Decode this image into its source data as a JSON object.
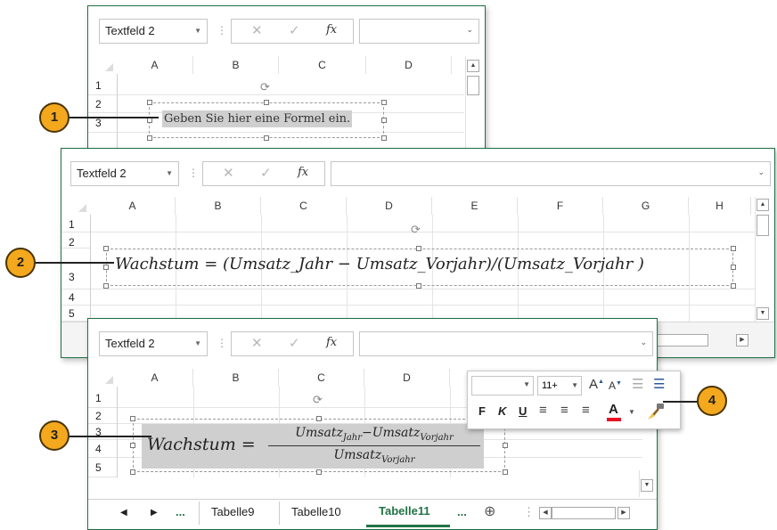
{
  "name_box": "Textfeld 2",
  "fx_label": "fx",
  "columns": [
    "A",
    "B",
    "C",
    "D",
    "E",
    "F",
    "G",
    "H"
  ],
  "rows": [
    "1",
    "2",
    "3",
    "4",
    "5"
  ],
  "window1": {
    "placeholder_text": "Geben Sie hier eine Formel ein."
  },
  "window2": {
    "equation": "Wachstum = (Umsatz_Jahr − Umsatz_Vorjahr)/(Umsatz_Vorjahr )"
  },
  "window3": {
    "eq_lhs": "Wachstum =",
    "num_a": "Umsatz",
    "num_a_sub": "Jahr",
    "num_minus": "−",
    "num_b": "Umsatz",
    "num_b_sub": "Vorjahr",
    "den": "Umsatz",
    "den_sub": "Vorjahr"
  },
  "mini_toolbar": {
    "font_size": "11+",
    "bold": "F",
    "italic": "K",
    "underline": "U",
    "font_color_letter": "A",
    "grow_font": "A",
    "shrink_font": "A",
    "font_color": "#e81123"
  },
  "sheet_tabs": {
    "ellipsis_left": "...",
    "tabs": [
      "Tabelle9",
      "Tabelle10",
      "Tabelle11"
    ],
    "ellipsis_right": "...",
    "active_color": "#217346"
  },
  "callouts": [
    "1",
    "2",
    "3",
    "4"
  ],
  "colors": {
    "accent": "#1e7145",
    "callout": "#f4a81d"
  }
}
